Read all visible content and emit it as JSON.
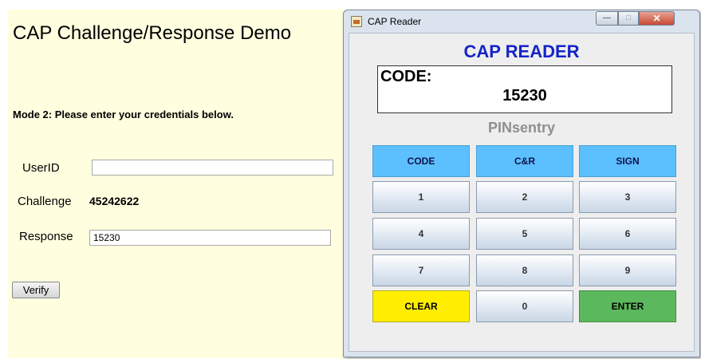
{
  "web": {
    "title": "CAP Challenge/Response Demo",
    "mode_text": "Mode 2: Please enter your credentials below.",
    "userid_label": "UserID",
    "userid_value": "",
    "challenge_label": "Challenge",
    "challenge_value": "45242622",
    "response_label": "Response",
    "response_value": "15230",
    "verify_label": "Verify"
  },
  "window": {
    "title": "CAP Reader",
    "controls": {
      "minimize": "—",
      "maximize": "□",
      "close": "✕"
    },
    "header": "CAP READER",
    "display_label": "CODE:",
    "display_value": "15230",
    "brand": "PINsentry",
    "keys": {
      "code": "CODE",
      "cr": "C&R",
      "sign": "SIGN",
      "k1": "1",
      "k2": "2",
      "k3": "3",
      "k4": "4",
      "k5": "5",
      "k6": "6",
      "k7": "7",
      "k8": "8",
      "k9": "9",
      "clear": "CLEAR",
      "k0": "0",
      "enter": "ENTER"
    }
  },
  "colors": {
    "page_bg": "#ffffe0",
    "header_blue": "#1424c8",
    "fn_key": "#5cc0ff",
    "clear_key": "#ffee00",
    "enter_key": "#5cb85c"
  },
  "icons": [
    "java-app-icon",
    "minimize-icon",
    "maximize-icon",
    "close-icon"
  ]
}
